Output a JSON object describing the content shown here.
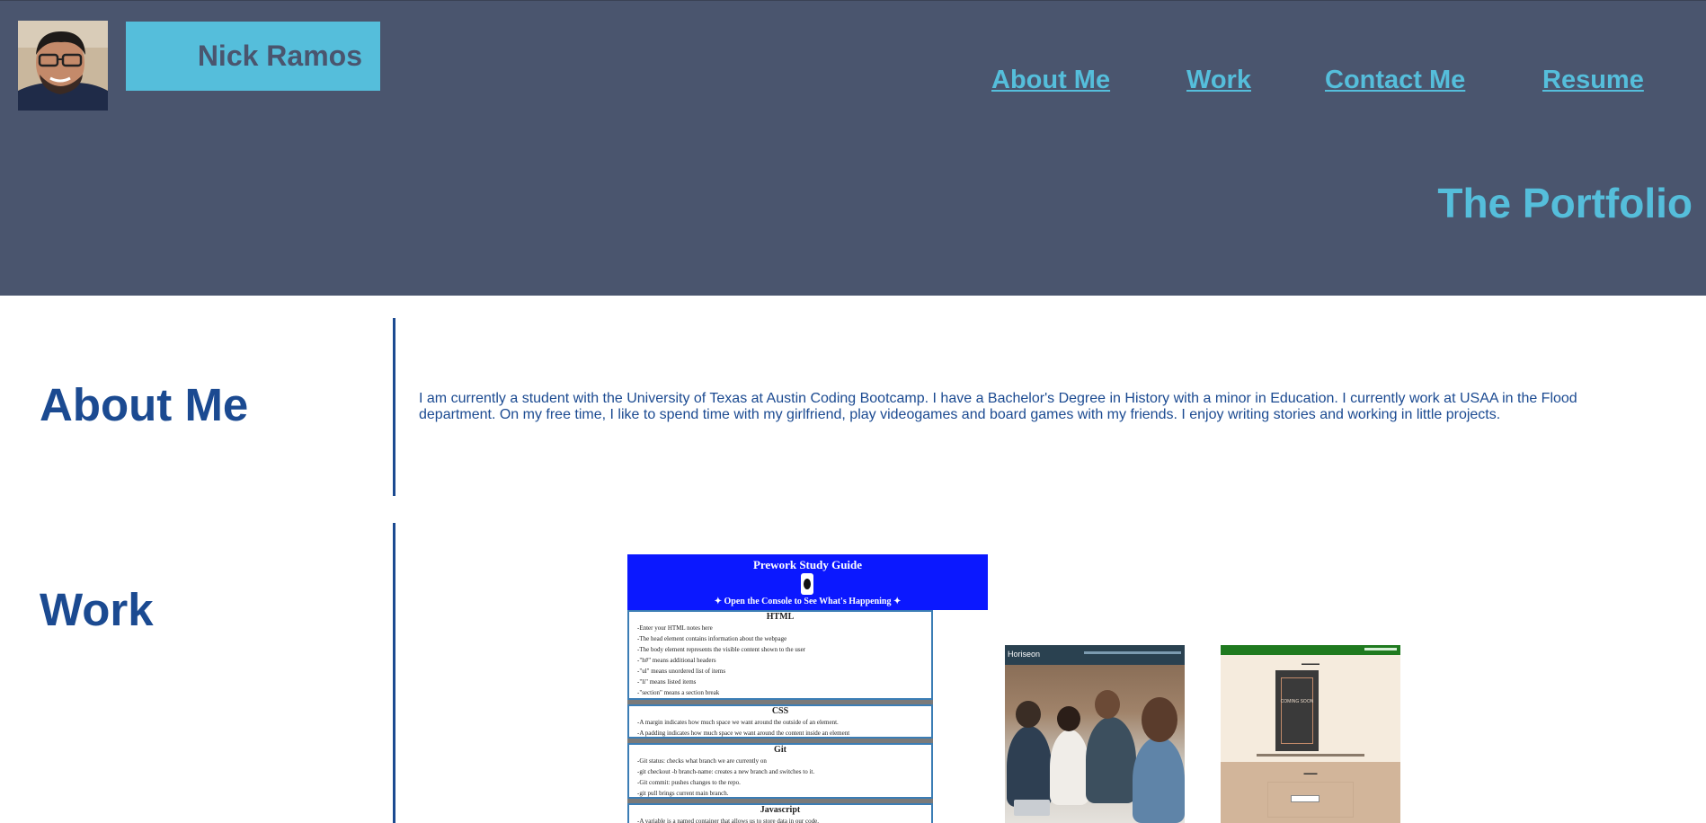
{
  "header": {
    "name": "Nick Ramos",
    "nav": [
      "About Me",
      "Work",
      "Contact Me",
      "Resume"
    ],
    "title": "The Portfolio"
  },
  "about": {
    "heading": "About Me",
    "text": "I am currently a student with the University of Texas at Austin Coding Bootcamp. I have a Bachelor's Degree in History with a minor in Education. I currently work at USAA in the Flood department. On my free time, I like to spend time with my girlfriend, play videogames and board games with my friends. I enjoy writing stories and working in little projects."
  },
  "work": {
    "heading": "Work",
    "prework": {
      "title": "Prework Study Guide",
      "console": "Open the Console to See What's Happening",
      "sections": [
        {
          "heading": "HTML",
          "lines": [
            "-Enter your HTML notes here",
            "-The head element contains information about the webpage",
            "-The body element represents the visible content shown to the user",
            "-\"h#\" means additional headers",
            "-\"ul\" means unordered list of items",
            "-\"li\" means listed items",
            "-\"section\" means a section break"
          ]
        },
        {
          "heading": "CSS",
          "lines": [
            "-A margin indicates how much space we want around the outside of an element.",
            "-A padding indicates how much space we want around the content inside an element"
          ]
        },
        {
          "heading": "Git",
          "lines": [
            "-Git status: checks what branch we are currently on",
            "-git checkout -b branch-name: creates a new branch and switches to it.",
            "-Git commit: pushes changes to the repo.",
            "-git pull brings current main branch."
          ]
        },
        {
          "heading": "Javascript",
          "lines": [
            "-A variable is a named container that allows us to store data in our code."
          ]
        }
      ]
    },
    "horiseon": {
      "logo": "Horiseon"
    },
    "coming_soon": {
      "book_text": "COMING SOON"
    }
  }
}
